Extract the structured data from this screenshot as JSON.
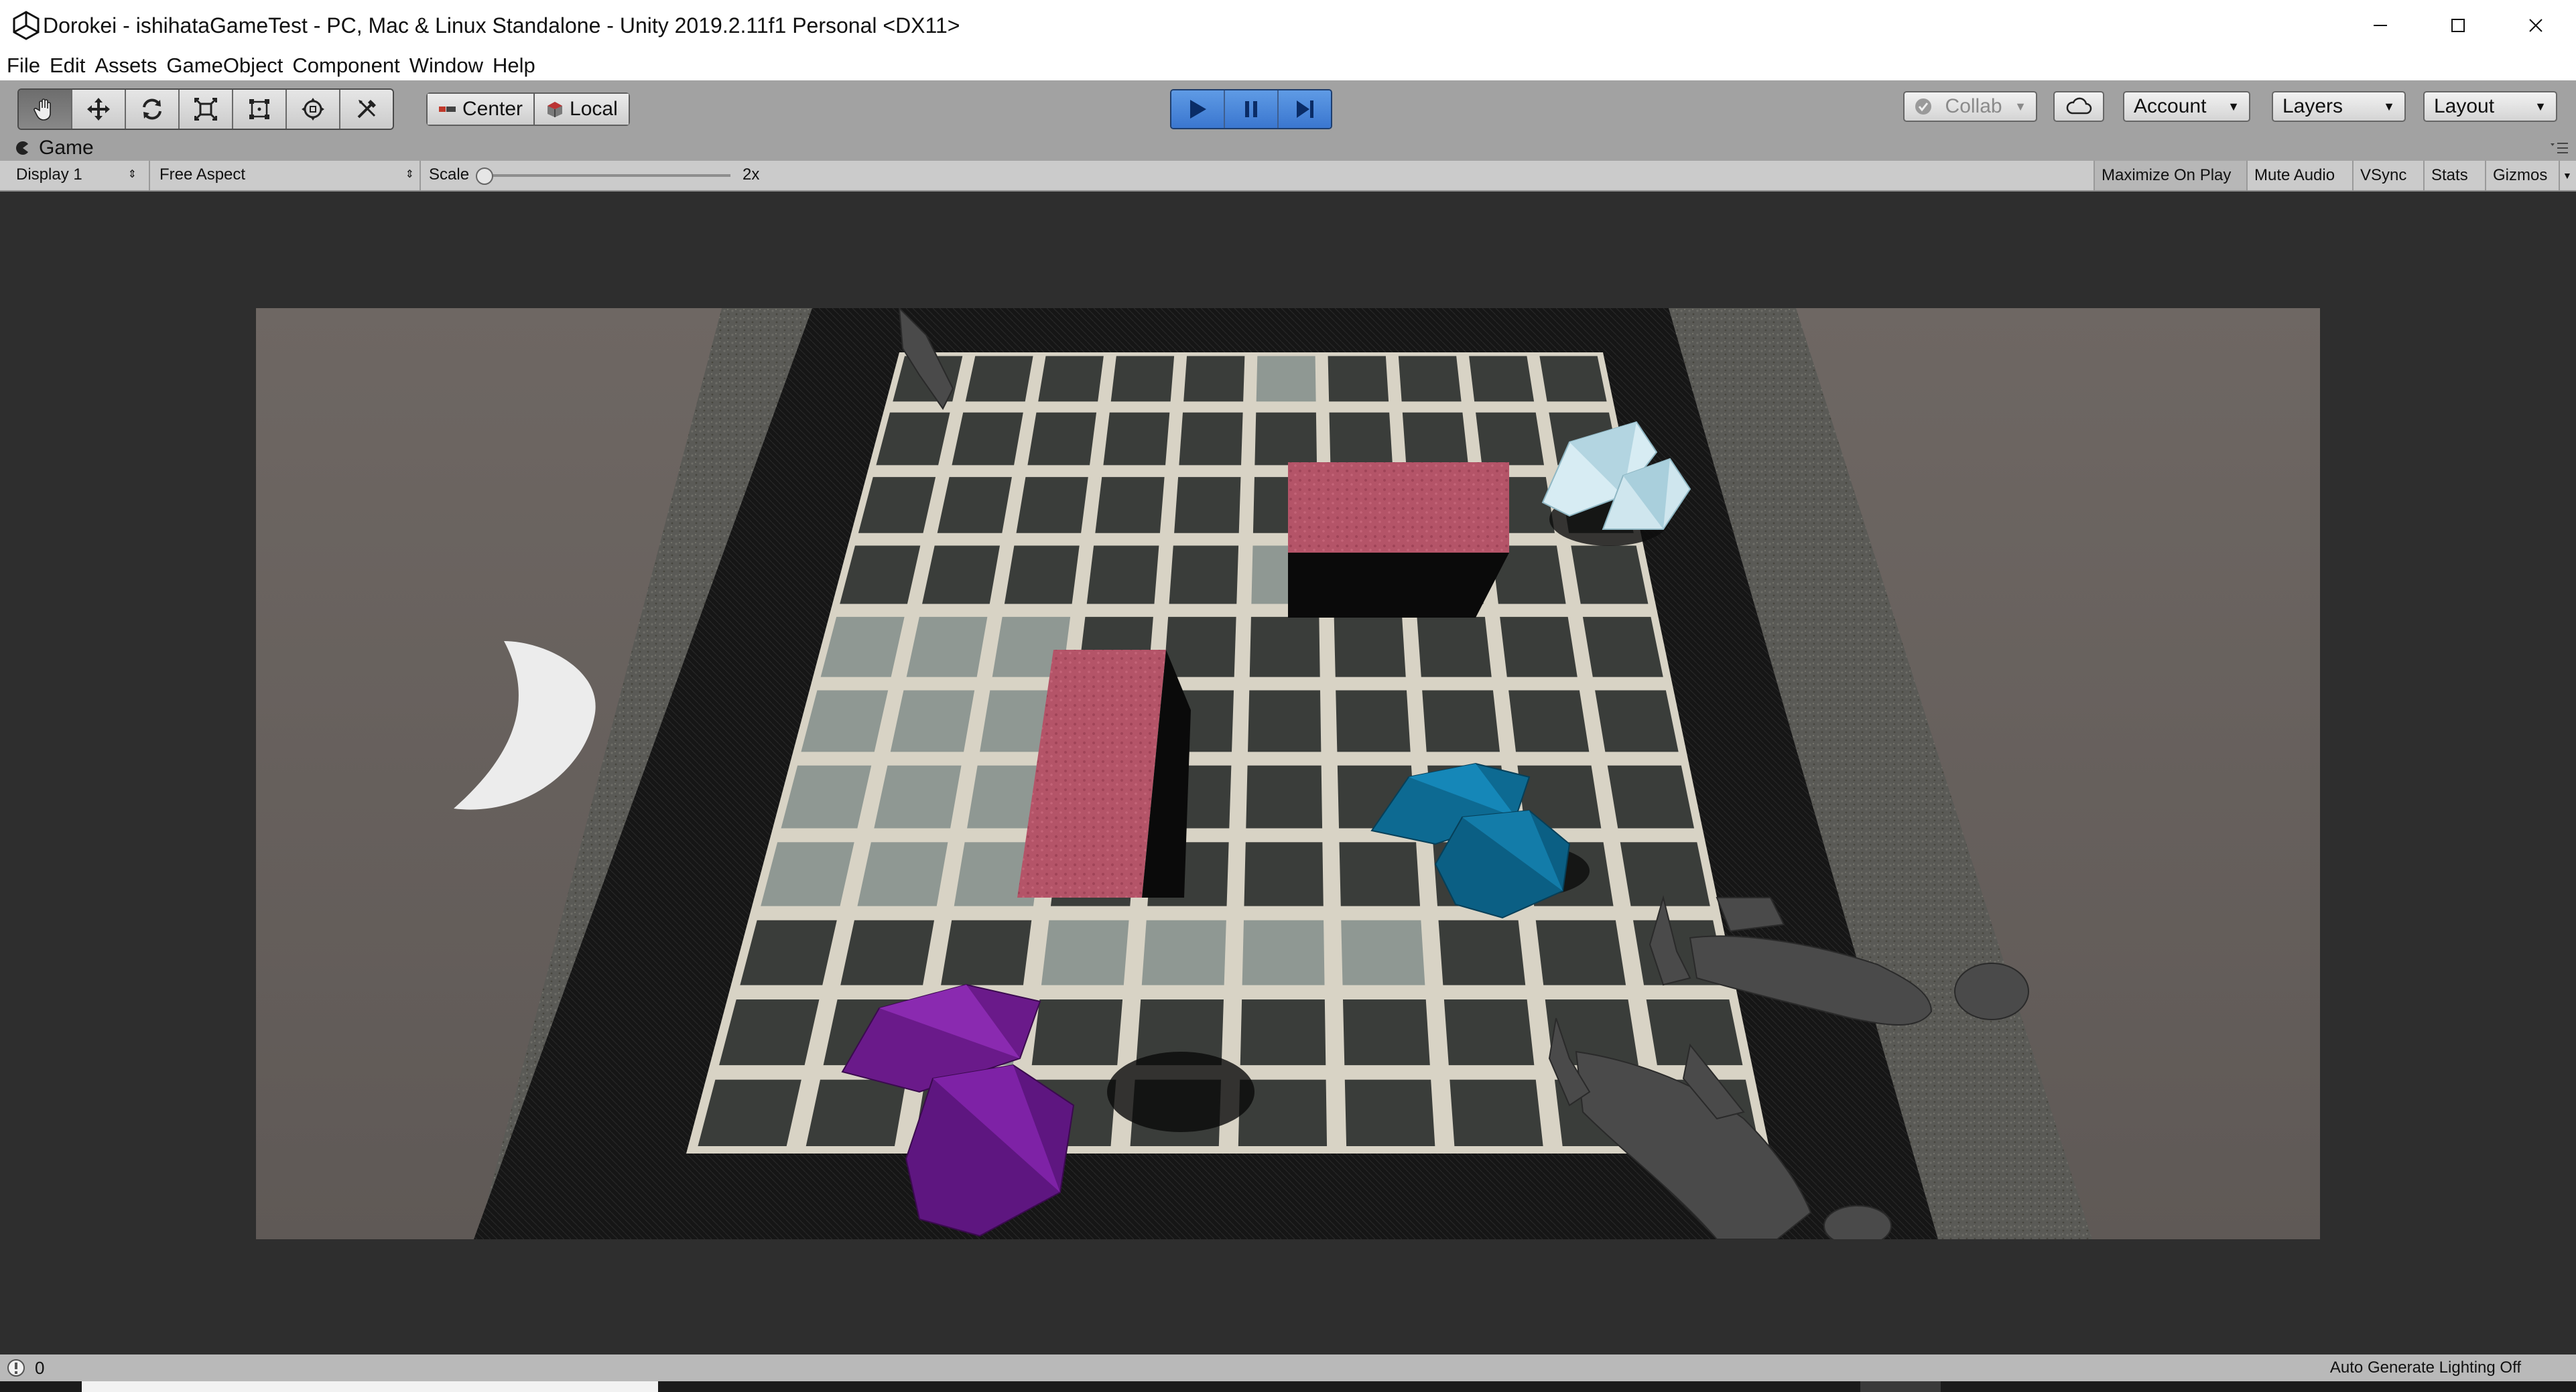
{
  "window": {
    "title": "Dorokei - ishihataGameTest - PC, Mac & Linux Standalone - Unity 2019.2.11f1 Personal <DX11>",
    "controls": [
      "minimize-icon",
      "maximize-icon",
      "close-icon"
    ]
  },
  "menu": [
    "File",
    "Edit",
    "Assets",
    "GameObject",
    "Component",
    "Window",
    "Help"
  ],
  "toolbar": {
    "tools": [
      "hand-icon",
      "move-icon",
      "rotate-icon",
      "scale-icon",
      "rect-icon",
      "transform-icon",
      "custom-tool-icon"
    ],
    "pivot_label": "Center",
    "space_label": "Local",
    "play_state": "playing",
    "collab_label": "Collab",
    "account_label": "Account",
    "layers_label": "Layers",
    "layout_label": "Layout"
  },
  "game_tab": {
    "label": "Game",
    "display": "Display 1",
    "aspect": "Free Aspect",
    "scale_label": "Scale",
    "scale_value": "2x",
    "scale_fraction": 0.0,
    "buttons": [
      "Maximize On Play",
      "Mute Audio",
      "VSync",
      "Stats",
      "Gizmos"
    ],
    "active_button": "Maximize On Play"
  },
  "status": {
    "count": "0",
    "lighting": "Auto Generate Lighting Off"
  },
  "colors": {
    "play_blue": "#3a76cf",
    "floor_tile": "#3a3d3a",
    "grout": "#d8d3c5",
    "box_top": "#b85468",
    "gem_purple": "#6a1a8a",
    "gem_blue": "#0d6a92",
    "gem_ice": "#cfe6ee"
  }
}
